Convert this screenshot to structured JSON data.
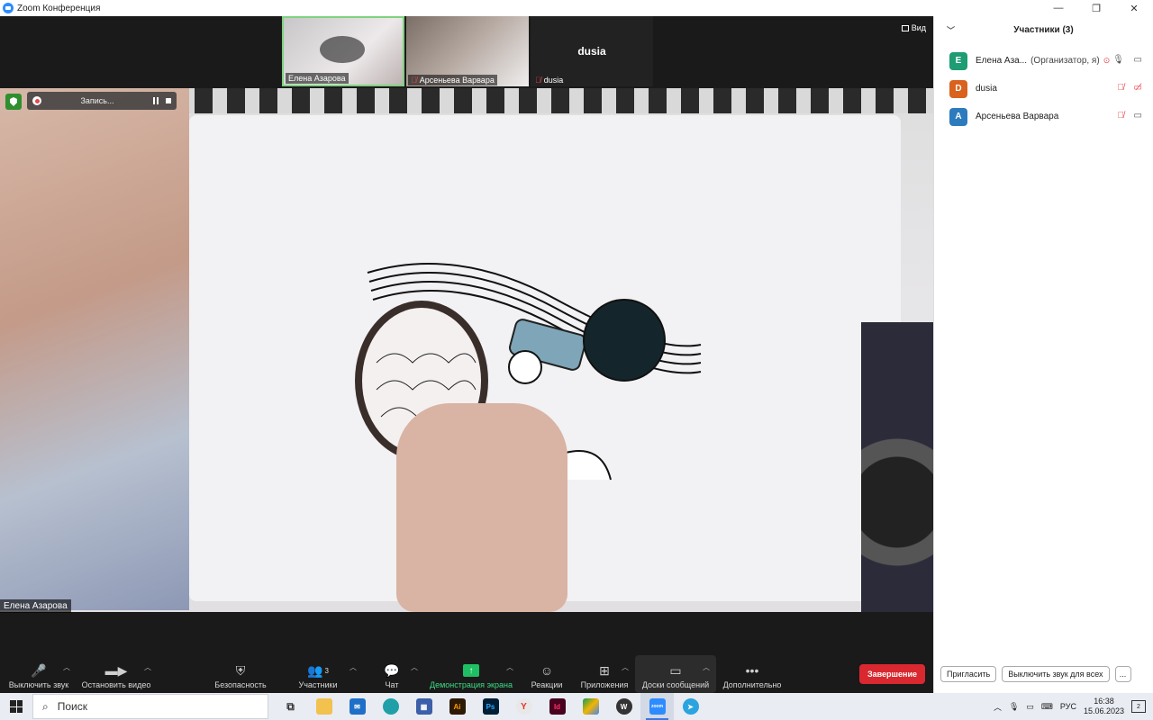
{
  "window": {
    "title": "Zoom Конференция",
    "controls": [
      "—",
      "❐",
      "✕"
    ]
  },
  "thumbnails": [
    {
      "name": "Елена Азарова",
      "muted": false
    },
    {
      "name": "Арсеньева Варвара",
      "muted": true
    },
    {
      "name": "dusia",
      "muted": true,
      "big_name": "dusia"
    }
  ],
  "view_button": "Вид",
  "recording": {
    "label": "Запись..."
  },
  "main_video": {
    "speaker_label": "Елена Азарова"
  },
  "toolbar": {
    "mute": "Выключить звук",
    "stop_video": "Остановить видео",
    "security": "Безопасность",
    "participants": "Участники",
    "participants_count": "3",
    "chat": "Чат",
    "share": "Демонстрация экрана",
    "reactions": "Реакции",
    "apps": "Приложения",
    "whiteboards": "Доски сообщений",
    "more": "Дополнительно",
    "end": "Завершение"
  },
  "participants_panel": {
    "title": "Участники (3)",
    "participants": [
      {
        "initial": "Е",
        "name": "Елена Аза...",
        "role": "(Организатор, я)",
        "color": "#1e9c73",
        "mic_muted": false,
        "cam_off": false
      },
      {
        "initial": "D",
        "name": "dusia",
        "role": "",
        "color": "#d9621e",
        "mic_muted": true,
        "cam_off": true
      },
      {
        "initial": "А",
        "name": "Арсеньева Варвара",
        "role": "",
        "color": "#2b7bbd",
        "mic_muted": true,
        "cam_off": false
      }
    ],
    "invite": "Пригласить",
    "mute_all": "Выключить звук для всех",
    "more": "..."
  },
  "taskbar": {
    "search": "Поиск",
    "lang": "РУС",
    "time": "16:38",
    "date": "15.06.2023",
    "notifications": "2"
  }
}
